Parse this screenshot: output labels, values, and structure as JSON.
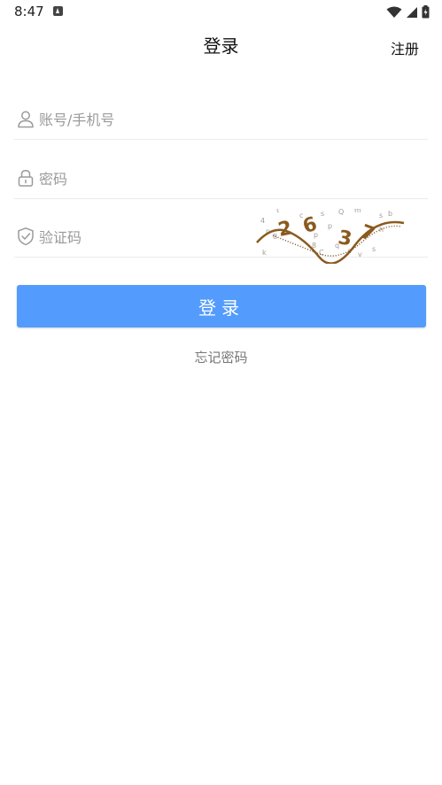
{
  "status_bar": {
    "time": "8:47",
    "icons": [
      "app-notification-icon",
      "wifi-icon",
      "signal-icon",
      "battery-icon"
    ]
  },
  "header": {
    "title": "登录",
    "register_label": "注册"
  },
  "form": {
    "account": {
      "placeholder": "账号/手机号",
      "value": "",
      "icon": "user-icon"
    },
    "password": {
      "placeholder": "密码",
      "value": "",
      "icon": "lock-icon"
    },
    "captcha": {
      "placeholder": "验证码",
      "value": "",
      "icon": "shield-check-icon",
      "image_text": "2637"
    }
  },
  "login_button_label": "登录",
  "forgot_password_label": "忘记密码",
  "colors": {
    "primary_button": "#539cfd",
    "divider": "#ececec",
    "placeholder": "#9a9a9a",
    "captcha_text": "#8a5a1e"
  }
}
